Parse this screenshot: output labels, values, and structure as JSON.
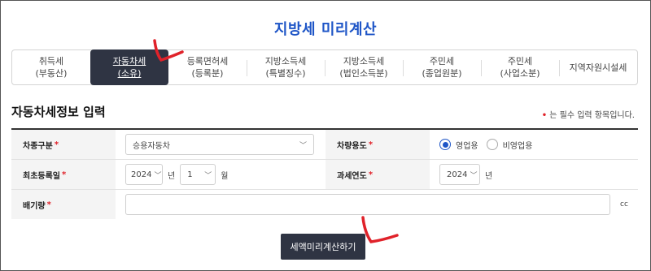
{
  "page": {
    "title": "지방세 미리계산"
  },
  "tabs": [
    {
      "line1": "취득세",
      "line2": "(부동산)",
      "active": false
    },
    {
      "line1": "자동차세",
      "line2": "(소유)",
      "active": true
    },
    {
      "line1": "등록면허세",
      "line2": "(등록분)",
      "active": false
    },
    {
      "line1": "지방소득세",
      "line2": "(특별징수)",
      "active": false
    },
    {
      "line1": "지방소득세",
      "line2": "(법인소득분)",
      "active": false
    },
    {
      "line1": "주민세",
      "line2": "(종업원분)",
      "active": false
    },
    {
      "line1": "주민세",
      "line2": "(사업소분)",
      "active": false
    },
    {
      "line1": "지역자원시설세",
      "line2": "",
      "active": false
    }
  ],
  "section": {
    "title": "자동차세정보 입력",
    "required_note_mark": "•",
    "required_note": " 는 필수 입력 항목입니다."
  },
  "form": {
    "required_mark": "*",
    "car_type": {
      "label": "차종구분",
      "value": "승용자동차"
    },
    "usage": {
      "label": "차량용도",
      "options": [
        "영업용",
        "비영업용"
      ],
      "selected": "영업용"
    },
    "first_registration": {
      "label": "최초등록일",
      "year": "2024",
      "year_unit": "년",
      "month": "1",
      "month_unit": "월"
    },
    "tax_year": {
      "label": "과세연도",
      "year": "2024",
      "year_unit": "년"
    },
    "displacement": {
      "label": "배기량",
      "value": "",
      "unit": "cc"
    }
  },
  "actions": {
    "calculate_label": "세액미리계산하기"
  },
  "colors": {
    "title": "#1f56c7",
    "active_tab": "#2f3443",
    "required": "#e0222a",
    "annotation": "#e0222a"
  }
}
